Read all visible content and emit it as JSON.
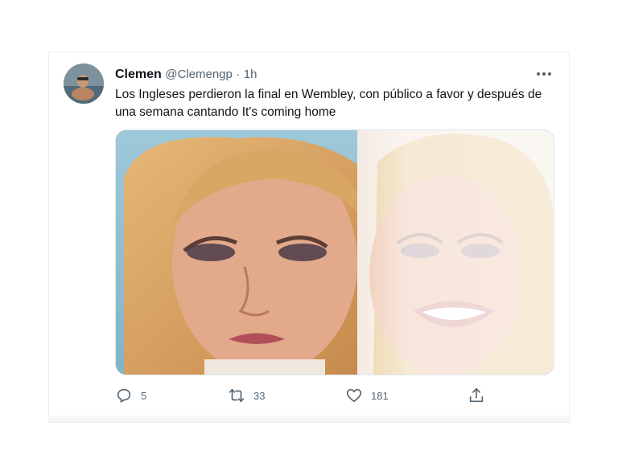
{
  "tweet": {
    "author_name": "Clemen",
    "author_handle": "@Clemengp",
    "separator": "·",
    "time": "1h",
    "text": "Los Ingleses perdieron la final en Wembley, con público a favor y después de una semana cantando It's coming home",
    "more_icon": "more-horizontal-icon",
    "media_description_icon": "image"
  },
  "actions": {
    "reply": {
      "icon": "reply-icon",
      "count": "5"
    },
    "retweet": {
      "icon": "retweet-icon",
      "count": "33"
    },
    "like": {
      "icon": "heart-icon",
      "count": "181"
    },
    "share": {
      "icon": "share-icon"
    }
  },
  "colors": {
    "text_primary": "#0f1419",
    "text_secondary": "#536471",
    "border": "#eceff1"
  }
}
